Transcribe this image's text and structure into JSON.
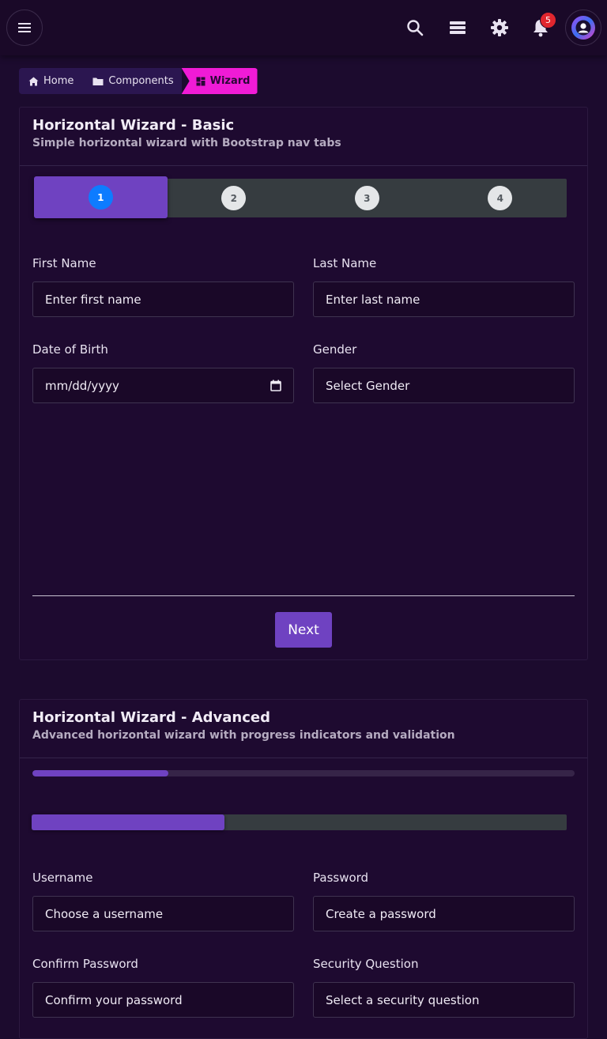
{
  "topbar": {
    "notification_count": "5",
    "icons": [
      "menu-icon",
      "search-icon",
      "stack-icon",
      "gear-icon",
      "bell-icon",
      "avatar"
    ]
  },
  "breadcrumb": {
    "items": [
      {
        "label": "Home",
        "icon": "home-icon"
      },
      {
        "label": "Components",
        "icon": "folder-icon"
      },
      {
        "label": "Wizard",
        "icon": "dashboard-icon"
      }
    ]
  },
  "basic_wizard": {
    "title": "Horizontal Wizard - Basic",
    "subtitle": "Simple horizontal wizard with Bootstrap nav tabs",
    "steps": [
      "1",
      "2",
      "3",
      "4"
    ],
    "active_step": 1,
    "fields": {
      "first_name": {
        "label": "First Name",
        "placeholder": "Enter first name"
      },
      "last_name": {
        "label": "Last Name",
        "placeholder": "Enter last name"
      },
      "dob": {
        "label": "Date of Birth",
        "placeholder": "mm/dd/yyyy"
      },
      "gender": {
        "label": "Gender",
        "placeholder": "Select Gender"
      }
    },
    "next_label": "Next"
  },
  "advanced_wizard": {
    "title": "Horizontal Wizard - Advanced",
    "subtitle": "Advanced horizontal wizard with progress indicators and validation",
    "progress_top": 0.25,
    "progress_steps": 0.36,
    "fields": {
      "username": {
        "label": "Username",
        "placeholder": "Choose a username"
      },
      "password": {
        "label": "Password",
        "placeholder": "Create a password"
      },
      "confirm_password": {
        "label": "Confirm Password",
        "placeholder": "Confirm your password"
      },
      "security_question": {
        "label": "Security Question",
        "placeholder": "Select a security question"
      }
    }
  },
  "colors": {
    "accent": "#6f42c1",
    "breadcrumb_active": "#f01bd6",
    "step_active_circle": "#0d7cff",
    "badge": "#e0262e"
  }
}
